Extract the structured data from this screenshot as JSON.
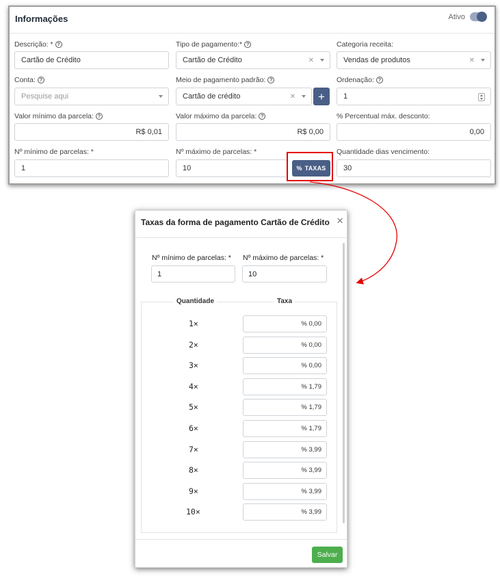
{
  "form": {
    "title": "Informações",
    "ativo_label": "Ativo",
    "descricao": {
      "label": "Descrição: *",
      "value": "Cartão de Crédito"
    },
    "tipo_pagamento": {
      "label": "Tipo de pagamento:*",
      "value": "Cartão de Crédito"
    },
    "categoria_receita": {
      "label": "Categoria receita:",
      "value": "Vendas de produtos"
    },
    "conta": {
      "label": "Conta:",
      "placeholder": "Pesquise aqui"
    },
    "meio_pagamento": {
      "label": "Meio de pagamento padrão:",
      "value": "Cartão de crédito",
      "add_label": "+"
    },
    "ordenacao": {
      "label": "Ordenação:",
      "value": "1"
    },
    "valor_min_parcela": {
      "label": "Valor mínimo da parcela:",
      "value": "R$ 0,01"
    },
    "valor_max_parcela": {
      "label": "Valor máximo da parcela:",
      "value": "R$ 0,00"
    },
    "percentual_desconto": {
      "label": "% Percentual máx. desconto:",
      "value": "0,00"
    },
    "min_parcelas": {
      "label": "Nº mínimo de parcelas: *",
      "value": "1"
    },
    "max_parcelas": {
      "label": "Nº máximo de parcelas: *",
      "value": "10"
    },
    "taxas_button": "TAXAS",
    "dias_vencimento": {
      "label": "Quantidade dias vencimento:",
      "value": "30"
    }
  },
  "icons": {
    "help": "help-circle-icon",
    "clear": "clear-x-icon",
    "dropdown": "chevron-down-icon",
    "percent": "percent-icon",
    "close": "close-icon"
  },
  "colors": {
    "primary": "#4a5f86",
    "success": "#4cae4c",
    "highlight": "#e60000"
  },
  "modal": {
    "title": "Taxas da forma de pagamento Cartão de Crédito",
    "close_glyph": "×",
    "min_parcelas": {
      "label": "Nº mínimo de parcelas: *",
      "value": "1"
    },
    "max_parcelas": {
      "label": "Nº máximo de parcelas: *",
      "value": "10"
    },
    "col_quantidade": "Quantidade",
    "col_taxa": "Taxa",
    "rates": [
      {
        "qty": "1×",
        "rate": "% 0,00"
      },
      {
        "qty": "2×",
        "rate": "% 0,00"
      },
      {
        "qty": "3×",
        "rate": "% 0,00"
      },
      {
        "qty": "4×",
        "rate": "% 1,79"
      },
      {
        "qty": "5×",
        "rate": "% 1,79"
      },
      {
        "qty": "6×",
        "rate": "% 1,79"
      },
      {
        "qty": "7×",
        "rate": "% 3,99"
      },
      {
        "qty": "8×",
        "rate": "% 3,99"
      },
      {
        "qty": "9×",
        "rate": "% 3,99"
      },
      {
        "qty": "10×",
        "rate": "% 3,99"
      }
    ],
    "save_label": "Salvar"
  }
}
